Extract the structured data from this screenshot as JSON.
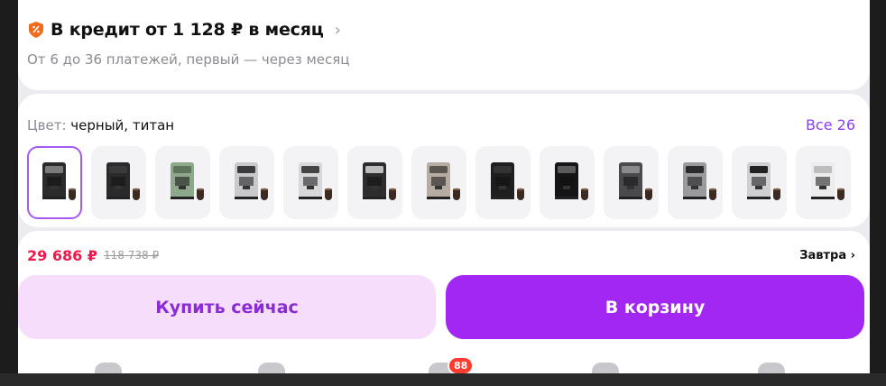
{
  "credit": {
    "title": "В кредит от 1 128 ₽ в месяц",
    "chevron": "›",
    "subtitle": "От 6 до 36 платежей, первый — через месяц",
    "icon": "shield-percent-icon",
    "icon_color": "#f26a1b"
  },
  "color": {
    "label_key": "Цвет:",
    "label_value": "черный, титан",
    "all_link": "Все 26",
    "variants": [
      {
        "name": "black-titan",
        "selected": true,
        "body": "#2b2b2b",
        "accent": "#7b7b7b"
      },
      {
        "name": "black-dark",
        "selected": false,
        "body": "#2a2a2a",
        "accent": "#3a3a3a"
      },
      {
        "name": "green",
        "selected": false,
        "body": "#8ea88c",
        "accent": "#5d7459"
      },
      {
        "name": "titan-white",
        "selected": false,
        "body": "#c9c9cc",
        "accent": "#3b3b3b"
      },
      {
        "name": "silver",
        "selected": false,
        "body": "#d8d8da",
        "accent": "#444"
      },
      {
        "name": "black-silver",
        "selected": false,
        "body": "#2d2d2d",
        "accent": "#bdbdbd"
      },
      {
        "name": "beige",
        "selected": false,
        "body": "#b6aca2",
        "accent": "#5b5550"
      },
      {
        "name": "black-compact",
        "selected": false,
        "body": "#1e1e1e",
        "accent": "#333"
      },
      {
        "name": "black-glossy",
        "selected": false,
        "body": "#151515",
        "accent": "#5a5a5a"
      },
      {
        "name": "graphite",
        "selected": false,
        "body": "#4a4a4c",
        "accent": "#8a8a8a"
      },
      {
        "name": "steel",
        "selected": false,
        "body": "#9a9a9d",
        "accent": "#2b2b2b"
      },
      {
        "name": "silver-black",
        "selected": false,
        "body": "#cfcfd2",
        "accent": "#222"
      },
      {
        "name": "white",
        "selected": false,
        "body": "#ececec",
        "accent": "#bdbdbd"
      }
    ]
  },
  "price": {
    "current": "29 686 ₽",
    "old": "118 738 ₽",
    "delivery": "Завтра ›",
    "current_color": "#f1184a"
  },
  "buttons": {
    "buy_now": "Купить сейчас",
    "add_to_cart": "В корзину"
  },
  "tabbar": {
    "cart_badge": "88"
  }
}
